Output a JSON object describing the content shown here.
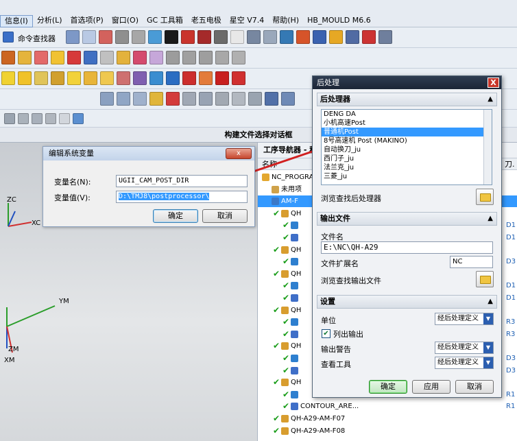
{
  "menubar": {
    "items": [
      "信息(I)",
      "分析(L)",
      "首选项(P)",
      "窗口(O)",
      "GC 工具箱",
      "老五电极",
      "星空 V7.4",
      "帮助(H)",
      "HB_MOULD M6.6"
    ]
  },
  "toolbar": {
    "command_finder": "命令查找器"
  },
  "build_dialog_title": "构建文件选择对话框",
  "viewport": {
    "axes": [
      "ZC",
      "XC",
      "YM",
      "ZM",
      "XM"
    ]
  },
  "env_dialog": {
    "title": "编辑系统变量",
    "var_name_label": "变量名(N):",
    "var_name_value": "UGII_CAM_POST_DIR",
    "var_value_label": "变量值(V):",
    "var_value_value": "D:\\TMJ8\\postprocessor\\",
    "ok": "确定",
    "cancel": "取消",
    "close": "x"
  },
  "opnav": {
    "title": "工序导航器 - 程",
    "col_name": "名称",
    "col_tool": "刀.",
    "rows": [
      {
        "text": "NC_PROGRAM",
        "right": ""
      },
      {
        "text": "未用项",
        "right": ""
      },
      {
        "text": "AM-F",
        "right": ""
      },
      {
        "text": "QH",
        "right": ""
      },
      {
        "text": "",
        "right": "D1"
      },
      {
        "text": "",
        "right": "D1"
      },
      {
        "text": "QH",
        "right": ""
      },
      {
        "text": "",
        "right": "D3"
      },
      {
        "text": "QH",
        "right": ""
      },
      {
        "text": "",
        "right": "D1"
      },
      {
        "text": "",
        "right": "D1"
      },
      {
        "text": "QH",
        "right": ""
      },
      {
        "text": "",
        "right": "R3"
      },
      {
        "text": "",
        "right": "R3"
      },
      {
        "text": "QH",
        "right": ""
      },
      {
        "text": "",
        "right": "D3"
      },
      {
        "text": "",
        "right": "D3"
      },
      {
        "text": "QH",
        "right": ""
      },
      {
        "text": "",
        "right": "R1"
      },
      {
        "text": "CONTOUR_ARE...",
        "right": "R1"
      },
      {
        "text": "QH-A29-AM-F07",
        "right": ""
      },
      {
        "text": "QH-A29-AM-F08",
        "right": ""
      }
    ]
  },
  "post_dialog": {
    "title": "后处理",
    "close": "X",
    "sec_post": "后处理器",
    "posts": [
      "DENG DA",
      "小机高速Post",
      "普通机Post",
      "8号高速机    Post (MAKINO)",
      "自动换刀_ju",
      "西门子_ju",
      "法兰克_ju",
      "三菱_ju"
    ],
    "selected_index": 2,
    "browse_post": "浏览查找后处理器",
    "sec_output": "输出文件",
    "filename_label": "文件名",
    "filename_value": "E:\\NC\\QH-A29",
    "ext_label": "文件扩展名",
    "ext_value": "NC",
    "browse_output": "浏览查找输出文件",
    "sec_settings": "设置",
    "units_label": "单位",
    "units_value": "经后处理定义",
    "list_output_label": "列出输出",
    "list_output_checked": true,
    "warnings_label": "输出警告",
    "warnings_value": "经后处理定义",
    "review_label": "查看工具",
    "review_value": "经后处理定义",
    "ok": "确定",
    "apply": "应用",
    "cancel": "取消"
  }
}
